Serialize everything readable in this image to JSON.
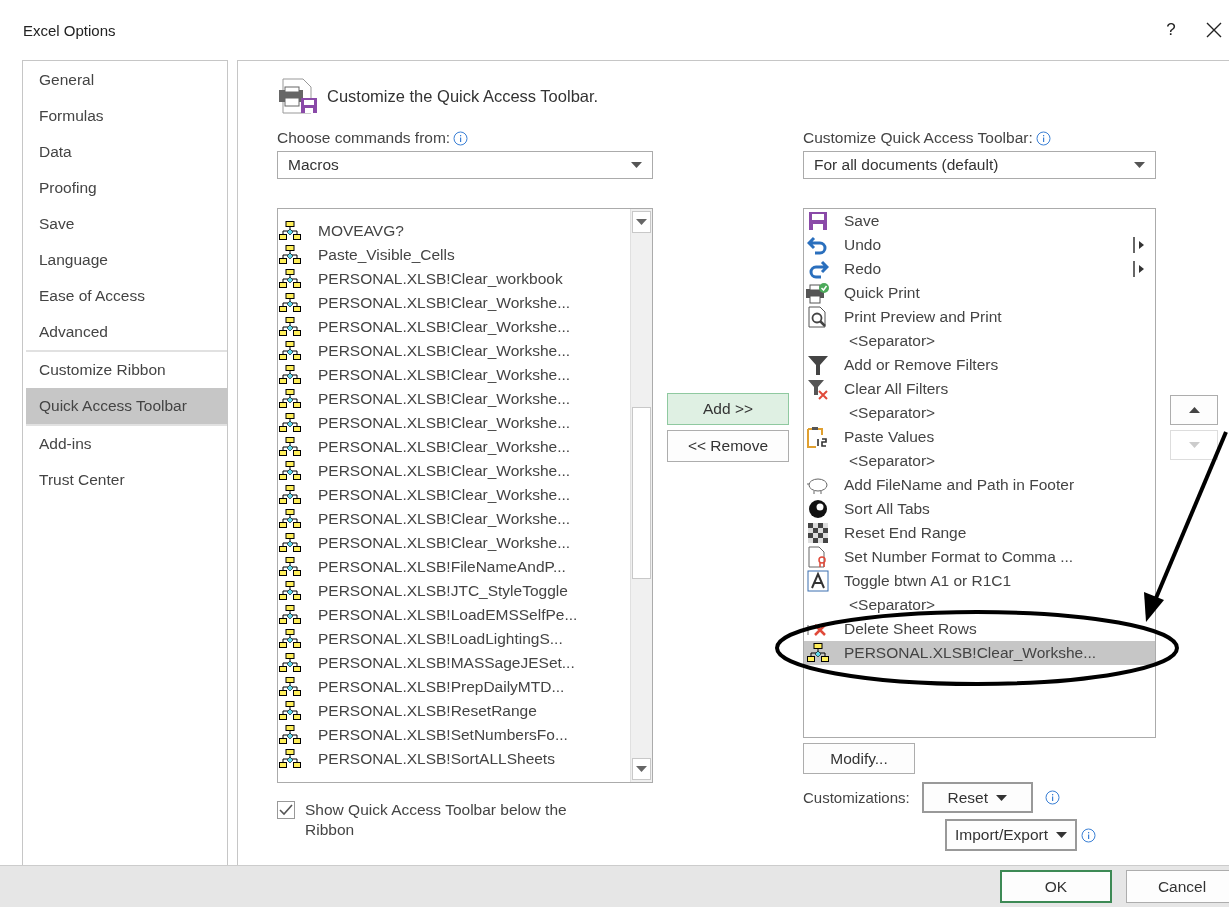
{
  "window": {
    "title": "Excel Options",
    "help": "?"
  },
  "sidebar": {
    "groups": [
      [
        {
          "label": "General",
          "selected": false
        },
        {
          "label": "Formulas",
          "selected": false
        },
        {
          "label": "Data",
          "selected": false
        },
        {
          "label": "Proofing",
          "selected": false
        },
        {
          "label": "Save",
          "selected": false
        },
        {
          "label": "Language",
          "selected": false
        },
        {
          "label": "Ease of Access",
          "selected": false
        },
        {
          "label": "Advanced",
          "selected": false
        }
      ],
      [
        {
          "label": "Customize Ribbon",
          "selected": false
        },
        {
          "label": "Quick Access Toolbar",
          "selected": true
        }
      ],
      [
        {
          "label": "Add-ins",
          "selected": false
        },
        {
          "label": "Trust Center",
          "selected": false
        }
      ]
    ]
  },
  "heading": "Customize the Quick Access Toolbar.",
  "commands_from": {
    "label": "Choose commands from:",
    "value": "Macros"
  },
  "commands": [
    "MOVEAVG?",
    "Paste_Visible_Cells",
    "PERSONAL.XLSB!Clear_workbook",
    "PERSONAL.XLSB!Clear_Workshe...",
    "PERSONAL.XLSB!Clear_Workshe...",
    "PERSONAL.XLSB!Clear_Workshe...",
    "PERSONAL.XLSB!Clear_Workshe...",
    "PERSONAL.XLSB!Clear_Workshe...",
    "PERSONAL.XLSB!Clear_Workshe...",
    "PERSONAL.XLSB!Clear_Workshe...",
    "PERSONAL.XLSB!Clear_Workshe...",
    "PERSONAL.XLSB!Clear_Workshe...",
    "PERSONAL.XLSB!Clear_Workshe...",
    "PERSONAL.XLSB!Clear_Workshe...",
    "PERSONAL.XLSB!FileNameAndP...",
    "PERSONAL.XLSB!JTC_StyleToggle",
    "PERSONAL.XLSB!LoadEMSSelfPe...",
    "PERSONAL.XLSB!LoadLightingS...",
    "PERSONAL.XLSB!MASSageJESet...",
    "PERSONAL.XLSB!PrepDailyMTD...",
    "PERSONAL.XLSB!ResetRange",
    "PERSONAL.XLSB!SetNumbersFo...",
    "PERSONAL.XLSB!SortALLSheets"
  ],
  "show_below_ribbon": {
    "label": "Show Quick Access Toolbar below the Ribbon",
    "checked": true
  },
  "add_button": "Add >>",
  "remove_button": "<< Remove",
  "customize_for": {
    "label": "Customize Quick Access Toolbar:",
    "value": "For all documents (default)"
  },
  "toolbar_items": [
    {
      "kind": "command",
      "label": "Save",
      "has_submenu": false,
      "selected": false
    },
    {
      "kind": "command",
      "label": "Undo",
      "has_submenu": true,
      "selected": false
    },
    {
      "kind": "command",
      "label": "Redo",
      "has_submenu": true,
      "selected": false
    },
    {
      "kind": "command",
      "label": "Quick Print",
      "has_submenu": false,
      "selected": false
    },
    {
      "kind": "command",
      "label": "Print Preview and Print",
      "has_submenu": false,
      "selected": false
    },
    {
      "kind": "separator",
      "label": "<Separator>",
      "selected": false
    },
    {
      "kind": "command",
      "label": "Add or Remove Filters",
      "has_submenu": false,
      "selected": false
    },
    {
      "kind": "command",
      "label": "Clear All Filters",
      "has_submenu": false,
      "selected": false
    },
    {
      "kind": "separator",
      "label": "<Separator>",
      "selected": false
    },
    {
      "kind": "command",
      "label": "Paste Values",
      "has_submenu": false,
      "selected": false
    },
    {
      "kind": "separator",
      "label": "<Separator>",
      "selected": false
    },
    {
      "kind": "command",
      "label": "Add FileName and Path in Footer",
      "has_submenu": false,
      "selected": false
    },
    {
      "kind": "command",
      "label": "Sort All Tabs",
      "has_submenu": false,
      "selected": false
    },
    {
      "kind": "command",
      "label": "Reset End Range",
      "has_submenu": false,
      "selected": false
    },
    {
      "kind": "command",
      "label": "Set Number Format to Comma ...",
      "has_submenu": false,
      "selected": false
    },
    {
      "kind": "command",
      "label": "Toggle btwn A1 or R1C1",
      "has_submenu": false,
      "selected": false
    },
    {
      "kind": "separator",
      "label": "<Separator>",
      "selected": false
    },
    {
      "kind": "command",
      "label": "Delete Sheet Rows",
      "has_submenu": false,
      "selected": false
    },
    {
      "kind": "command",
      "label": "PERSONAL.XLSB!Clear_Workshe...",
      "has_submenu": false,
      "selected": true
    }
  ],
  "modify_button": "Modify...",
  "customizations": {
    "label": "Customizations:",
    "reset": "Reset",
    "import_export": "Import/Export"
  },
  "footer": {
    "ok": "OK",
    "cancel": "Cancel"
  }
}
